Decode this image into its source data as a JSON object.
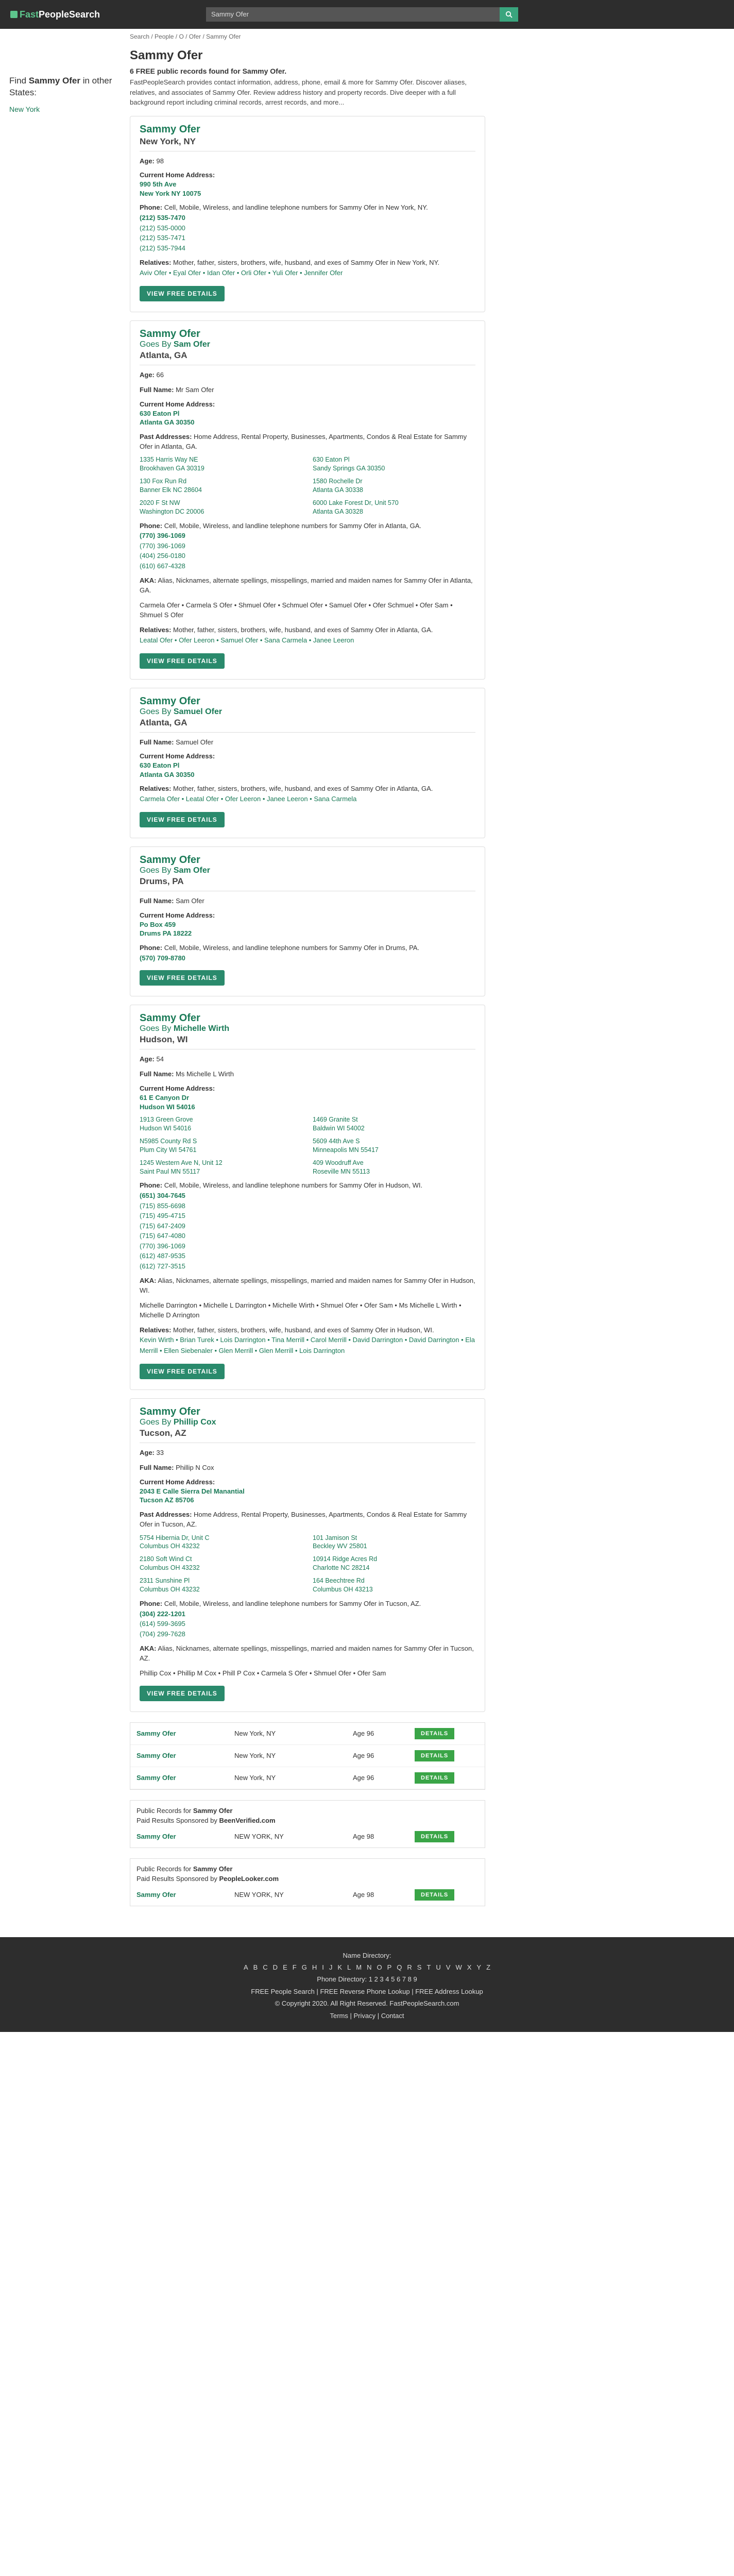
{
  "header": {
    "brand_fast": "Fast",
    "brand_rest": "PeopleSearch",
    "search_value": "Sammy Ofer"
  },
  "sidebar": {
    "find_prefix": "Find ",
    "find_name": "Sammy Ofer",
    "find_suffix": " in other States:",
    "state_link": "New York"
  },
  "breadcrumb": [
    "Search",
    "People",
    "O",
    "Ofer",
    "Sammy Ofer"
  ],
  "page": {
    "title": "Sammy Ofer",
    "found": "6 FREE public records found for Sammy Ofer.",
    "intro": "FastPeopleSearch provides contact information, address, phone, email & more for Sammy Ofer. Discover aliases, relatives, and associates of Sammy Ofer. Review address history and property records. Dive deeper with a full background report including criminal records, arrest records, and more..."
  },
  "labels": {
    "age": "Age:",
    "full_name": "Full Name:",
    "current_home": "Current Home Address:",
    "past_addresses": "Past Addresses:",
    "phone": "Phone:",
    "aka": "AKA:",
    "relatives": "Relatives:",
    "view_details": "VIEW FREE DETAILS",
    "goes_by": "Goes By"
  },
  "records": [
    {
      "name": "Sammy Ofer",
      "location": "New York, NY",
      "age": "98",
      "address": [
        "990 5th Ave",
        "New York NY 10075"
      ],
      "phone_text": "Cell, Mobile, Wireless, and landline telephone numbers for Sammy Ofer in New York, NY.",
      "phones": [
        "(212) 535-7470",
        "(212) 535-0000",
        "(212) 535-7471",
        "(212) 535-7944"
      ],
      "relatives_text": "Mother, father, sisters, brothers, wife, husband, and exes of Sammy Ofer in New York, NY.",
      "relatives": "Aviv Ofer • Eyal Ofer • Idan Ofer • Orli Ofer • Yuli Ofer • Jennifer Ofer"
    },
    {
      "name": "Sammy Ofer",
      "goes_by": "Sam Ofer",
      "location": "Atlanta, GA",
      "age": "66",
      "full_name": "Mr Sam Ofer",
      "address": [
        "630 Eaton Pl",
        "Atlanta GA 30350"
      ],
      "past_text": "Home Address, Rental Property, Businesses, Apartments, Condos & Real Estate for Sammy Ofer in Atlanta, GA.",
      "past": [
        "1335 Harris Way NE|Brookhaven GA 30319",
        "630 Eaton Pl|Sandy Springs GA 30350",
        "130 Fox Run Rd|Banner Elk NC 28604",
        "1580 Rochelle Dr|Atlanta GA 30338",
        "2020 F St NW|Washington DC 20006",
        "6000 Lake Forest Dr, Unit 570|Atlanta GA 30328"
      ],
      "phone_text": "Cell, Mobile, Wireless, and landline telephone numbers for Sammy Ofer in Atlanta, GA.",
      "phones": [
        "(770) 396-1069",
        "(770) 396-1069",
        "(404) 256-0180",
        "(610) 667-4328"
      ],
      "aka_text": "Alias, Nicknames, alternate spellings, misspellings, married and maiden names for Sammy Ofer in Atlanta, GA.",
      "aka": "Carmela Ofer • Carmela S Ofer • Shmuel Ofer • Schmuel Ofer • Samuel Ofer • Ofer Schmuel • Ofer Sam • Shmuel S Ofer",
      "relatives_text": "Mother, father, sisters, brothers, wife, husband, and exes of Sammy Ofer in Atlanta, GA.",
      "relatives": "Leatal Ofer • Ofer Leeron • Samuel Ofer • Sana Carmela • Janee Leeron"
    },
    {
      "name": "Sammy Ofer",
      "goes_by": "Samuel Ofer",
      "location": "Atlanta, GA",
      "full_name": "Samuel Ofer",
      "address": [
        "630 Eaton Pl",
        "Atlanta GA 30350"
      ],
      "relatives_text": "Mother, father, sisters, brothers, wife, husband, and exes of Sammy Ofer in Atlanta, GA.",
      "relatives": "Carmela Ofer • Leatal Ofer • Ofer Leeron • Janee Leeron • Sana Carmela"
    },
    {
      "name": "Sammy Ofer",
      "goes_by": "Sam Ofer",
      "location": "Drums, PA",
      "full_name": "Sam Ofer",
      "address": [
        "Po Box 459",
        "Drums PA 18222"
      ],
      "phone_text": "Cell, Mobile, Wireless, and landline telephone numbers for Sammy Ofer in Drums, PA.",
      "phones": [
        "(570) 709-8780"
      ]
    },
    {
      "name": "Sammy Ofer",
      "goes_by": "Michelle Wirth",
      "location": "Hudson, WI",
      "age": "54",
      "full_name": "Ms Michelle L Wirth",
      "address": [
        "61 E Canyon Dr",
        "Hudson WI 54016"
      ],
      "past": [
        "1913 Green Grove|Hudson WI 54016",
        "1469 Granite St|Baldwin WI 54002",
        "N5985 County Rd S|Plum City WI 54761",
        "5609 44th Ave S|Minneapolis MN 55417",
        "1245 Western Ave N, Unit 12|Saint Paul MN 55117",
        "409 Woodruff Ave|Roseville MN 55113"
      ],
      "phone_text": "Cell, Mobile, Wireless, and landline telephone numbers for Sammy Ofer in Hudson, WI.",
      "phones": [
        "(651) 304-7645",
        "(715) 855-6698",
        "(715) 495-4715",
        "(715) 647-2409",
        "(715) 647-4080",
        "(770) 396-1069",
        "(612) 487-9535",
        "(612) 727-3515"
      ],
      "aka_text": "Alias, Nicknames, alternate spellings, misspellings, married and maiden names for Sammy Ofer in Hudson, WI.",
      "aka": "Michelle Darrington • Michelle L Darrington • Michelle Wirth • Shmuel Ofer • Ofer Sam • Ms Michelle L Wirth • Michelle D Arrington",
      "relatives_text": "Mother, father, sisters, brothers, wife, husband, and exes of Sammy Ofer in Hudson, WI.",
      "relatives": "Kevin Wirth • Brian Turek • Lois Darrington • Tina Merrill • Carol Merrill • David Darrington • David Darrington • Ela Merrill • Ellen Siebenaler • Glen Merrill • Glen Merrill • Lois Darrington"
    },
    {
      "name": "Sammy Ofer",
      "goes_by": "Phillip Cox",
      "location": "Tucson, AZ",
      "age": "33",
      "full_name": "Phillip N Cox",
      "address": [
        "2043 E Calle Sierra Del Manantial",
        "Tucson AZ 85706"
      ],
      "past_text": "Home Address, Rental Property, Businesses, Apartments, Condos & Real Estate for Sammy Ofer in Tucson, AZ.",
      "past": [
        "5754 Hibernia Dr, Unit C|Columbus OH 43232",
        "101 Jamison St|Beckley WV 25801",
        "2180 Soft Wind Ct|Columbus OH 43232",
        "10914 Ridge Acres Rd|Charlotte NC 28214",
        "2311 Sunshine Pl|Columbus OH 43232",
        "164 Beechtree Rd|Columbus OH 43213"
      ],
      "phone_text": "Cell, Mobile, Wireless, and landline telephone numbers for Sammy Ofer in Tucson, AZ.",
      "phones": [
        "(304) 222-1201",
        "(614) 599-3695",
        "(704) 299-7628"
      ],
      "aka_text": "Alias, Nicknames, alternate spellings, misspellings, married and maiden names for Sammy Ofer in Tucson, AZ.",
      "aka": "Phillip Cox • Phillip M Cox • Phill P Cox • Carmela S Ofer • Shmuel Ofer • Ofer Sam"
    }
  ],
  "results_table": [
    {
      "name": "Sammy Ofer",
      "city": "New York, NY",
      "age": "Age 96"
    },
    {
      "name": "Sammy Ofer",
      "city": "New York, NY",
      "age": "Age 96"
    },
    {
      "name": "Sammy Ofer",
      "city": "New York, NY",
      "age": "Age 96"
    }
  ],
  "sponsored": [
    {
      "line1_prefix": "Public Records for ",
      "line1_name": "Sammy Ofer",
      "line2_prefix": "Paid Results Sponsored by ",
      "sponsor": "BeenVerified.com",
      "name": "Sammy Ofer",
      "city": "NEW YORK, NY",
      "age": "Age 98"
    },
    {
      "line1_prefix": "Public Records for ",
      "line1_name": "Sammy Ofer",
      "line2_prefix": "Paid Results Sponsored by ",
      "sponsor": "PeopleLooker.com",
      "name": "Sammy Ofer",
      "city": "NEW YORK, NY",
      "age": "Age 98"
    }
  ],
  "details_btn": "DETAILS",
  "footer": {
    "name_directory": "Name Directory:",
    "letters": [
      "A",
      "B",
      "C",
      "D",
      "E",
      "F",
      "G",
      "H",
      "I",
      "J",
      "K",
      "L",
      "M",
      "N",
      "O",
      "P",
      "Q",
      "R",
      "S",
      "T",
      "U",
      "V",
      "W",
      "X",
      "Y",
      "Z"
    ],
    "phone_directory": "Phone Directory:",
    "phone_digits": [
      "1",
      "2",
      "3",
      "4",
      "5",
      "6",
      "7",
      "8",
      "9"
    ],
    "links": "FREE People Search | FREE Reverse Phone Lookup | FREE Address Lookup",
    "copyright": "© Copyright 2020. All Right Reserved. FastPeopleSearch.com",
    "bottom": "Terms | Privacy | Contact"
  }
}
